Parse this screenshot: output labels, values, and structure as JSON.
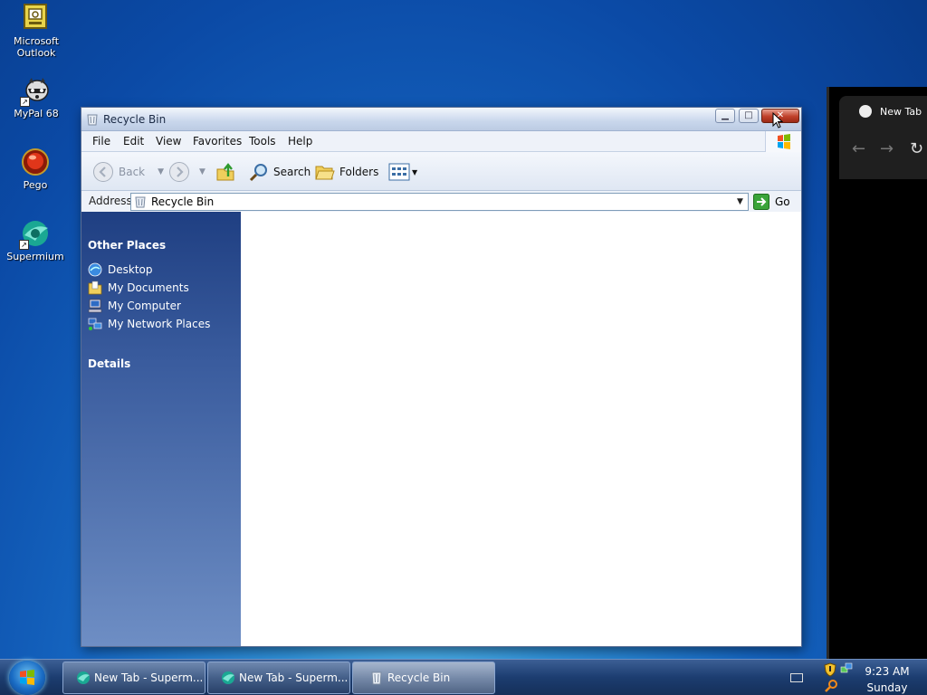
{
  "desktop": {
    "icons": [
      {
        "label_line1": "Microsoft",
        "label_line2": "Outlook",
        "icon": "outlook-icon"
      },
      {
        "label": "MyPal 68",
        "icon": "raccoon-icon"
      },
      {
        "label": "Pego",
        "icon": "pego-icon"
      },
      {
        "label": "Supermium",
        "icon": "supermium-icon"
      }
    ]
  },
  "window": {
    "title": "Recycle Bin",
    "caption_minimize": "▁",
    "caption_maximize": "□",
    "caption_close": "✕",
    "menu": [
      "File",
      "Edit",
      "View",
      "Favorites",
      "Tools",
      "Help"
    ],
    "toolbar": {
      "back": "Back",
      "search": "Search",
      "folders": "Folders"
    },
    "address": {
      "label": "Address",
      "value": "Recycle Bin",
      "go": "Go"
    },
    "taskpane": {
      "other_places_title": "Other Places",
      "links": [
        "Desktop",
        "My Documents",
        "My Computer",
        "My Network Places"
      ],
      "details_title": "Details"
    }
  },
  "browser": {
    "tab_title": "New Tab"
  },
  "taskbar": {
    "tasks": [
      {
        "label": "New Tab - Superm...",
        "icon": "supermium-icon"
      },
      {
        "label": "New Tab - Superm...",
        "icon": "supermium-icon"
      },
      {
        "label": "Recycle Bin",
        "icon": "recycle-bin-icon"
      }
    ],
    "clock_time": "9:23 AM",
    "clock_day": "Sunday"
  },
  "colors": {
    "taskpane_top": "#1f3f82",
    "taskpane_bottom": "#6e8ec4",
    "close_button": "#c0402a",
    "desktop": "#1565c0"
  }
}
